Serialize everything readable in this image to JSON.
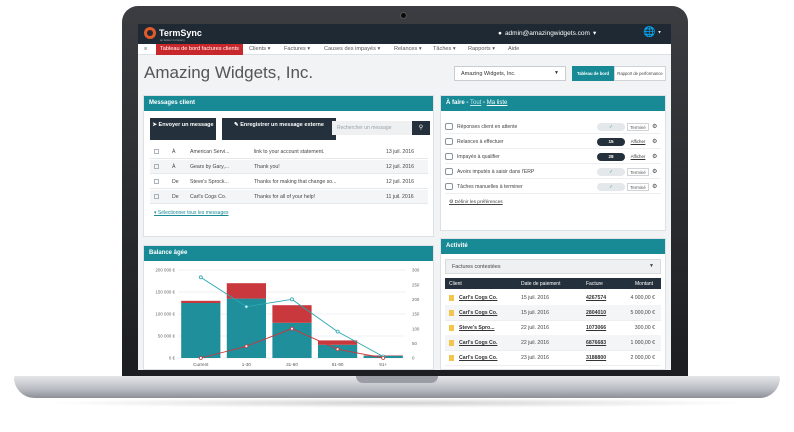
{
  "brand": {
    "name": "TermSync",
    "tagline": "an Esker company",
    "logo_color": "#e05a2b"
  },
  "user": {
    "icon": "user-icon",
    "label": "admin@amazingwidgets.com",
    "menu_caret": "▾"
  },
  "globe": {
    "icon": "globe-icon",
    "caret": "▾"
  },
  "nav": {
    "home_icon": "≡",
    "items": [
      {
        "label": "Tableau de bord factures clients",
        "active": true
      },
      {
        "label": "Clients ▾"
      },
      {
        "label": "Factures ▾"
      },
      {
        "label": "Causes des impayés ▾"
      },
      {
        "label": "Relances ▾"
      },
      {
        "label": "Tâches ▾"
      },
      {
        "label": "Rapports ▾"
      },
      {
        "label": "Aide"
      }
    ]
  },
  "header": {
    "company_title": "Amazing Widgets, Inc.",
    "company_select": "Amazing Widgets, Inc.",
    "board_button": "Tableau de bord",
    "perf_button": "Rapport de performance"
  },
  "messages": {
    "title": "Messages client",
    "send_button": "Envoyer un message",
    "save_button": "Enregistrer un message externe",
    "search_placeholder": "Rechercher un message",
    "rows": [
      {
        "dir": "À",
        "who": "American Servi...",
        "text": "link to your account statement.",
        "date": "13 juil. 2016"
      },
      {
        "dir": "À",
        "who": "Gears by Gary,...",
        "text": "Thank you!",
        "date": "12 juil. 2016"
      },
      {
        "dir": "De",
        "who": "Steve's Sprock...",
        "text": "Thanks for making that change so...",
        "date": "12 juil. 2016"
      },
      {
        "dir": "De",
        "who": "Carl's Cogs Co.",
        "text": "Thanks for all of your help!",
        "date": "11 juil. 2016"
      }
    ],
    "select_all": "Sélectionner tous les messages"
  },
  "balance": {
    "title": "Balance âgée"
  },
  "chart_data": {
    "type": "bar",
    "title": "Balance âgée",
    "categories": [
      "Current",
      "1-30",
      "31-60",
      "61-90",
      "91+"
    ],
    "series": [
      {
        "values": [
          125000,
          135000,
          80000,
          30000,
          5000
        ],
        "color": "#1f8f9c"
      },
      {
        "values": [
          5000,
          35000,
          40000,
          10000,
          1000
        ],
        "color": "#c8383c"
      },
      {
        "values": [
          275,
          175,
          200,
          90,
          5
        ],
        "color": "#2aa7b3",
        "kind": "line",
        "axis": "right"
      },
      {
        "values": [
          0,
          40,
          100,
          30,
          0
        ],
        "color": "#c8383c",
        "kind": "line",
        "axis": "right"
      }
    ],
    "ylabels_left": [
      "200 000 €",
      "150 000 €",
      "100 000 €",
      "50 000 €",
      "0 €"
    ],
    "ylabels_right": [
      "300",
      "250",
      "200",
      "150",
      "100",
      "50",
      "0"
    ],
    "ylim": [
      0,
      200000
    ],
    "ylim_right": [
      0,
      300
    ]
  },
  "todo": {
    "title": "À faire",
    "link_all": "Tout",
    "link_mine": "Ma liste",
    "rows": [
      {
        "icon": "chat-icon",
        "label": "Réponses client en attente",
        "count": "✓",
        "count_style": "light",
        "action": "Terminé",
        "action_style": "box"
      },
      {
        "icon": "refresh-icon",
        "label": "Relances à effectuer",
        "count": "15",
        "count_style": "dark",
        "action": "Afficher",
        "action_style": "link"
      },
      {
        "icon": "search-icon",
        "label": "Impayés à qualifier",
        "count": "28",
        "count_style": "dark",
        "action": "Afficher",
        "action_style": "link"
      },
      {
        "icon": "list-icon",
        "label": "Avoirs imputés à saisir dans l'ERP",
        "count": "✓",
        "count_style": "light",
        "action": "Terminé",
        "action_style": "box"
      },
      {
        "icon": "chat-icon",
        "label": "Tâches manuelles à terminer",
        "count": "✓",
        "count_style": "light",
        "action": "Terminé",
        "action_style": "box"
      }
    ],
    "prefs_link": "Définir les préférences"
  },
  "activity": {
    "title": "Activité",
    "select": "Factures contestées",
    "columns": [
      "Client",
      "Date de paiement",
      "Facture",
      "Montant"
    ],
    "rows": [
      {
        "client": "Carl's Cogs Co.",
        "date": "15 juil. 2016",
        "invoice": "4267574",
        "amount": "4 000,00 €"
      },
      {
        "client": "Carl's Cogs Co.",
        "date": "15 juil. 2016",
        "invoice": "2804010",
        "amount": "5 000,00 €"
      },
      {
        "client": "Steve's Spro...",
        "date": "22 juil. 2016",
        "invoice": "1073066",
        "amount": "300,00 €"
      },
      {
        "client": "Carl's Cogs Co.",
        "date": "22 juil. 2016",
        "invoice": "6876683",
        "amount": "1 000,00 €"
      },
      {
        "client": "Carl's Cogs Co.",
        "date": "23 juil. 2016",
        "invoice": "3188800",
        "amount": "2 000,00 €"
      }
    ]
  },
  "colors": {
    "teal": "#178a96",
    "red": "#c8282c",
    "dark": "#24303b"
  }
}
